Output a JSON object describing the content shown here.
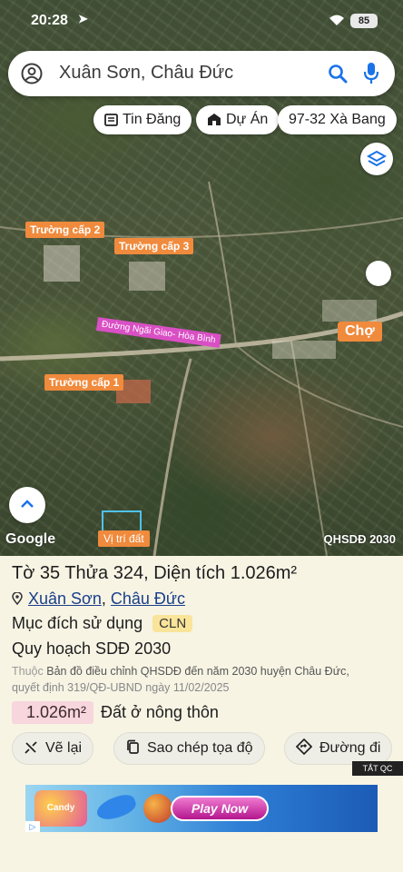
{
  "status_bar": {
    "time": "20:28",
    "battery": "85"
  },
  "search": {
    "query": "Xuân Sơn, Châu Đức"
  },
  "chips": [
    {
      "label": "Tin Đăng",
      "icon": "newspaper-icon"
    },
    {
      "label": "Dự Án",
      "icon": "building-icon"
    },
    {
      "label": "97-32 Xà Bang",
      "icon": ""
    }
  ],
  "map": {
    "labels": {
      "school2": "Trường cấp 2",
      "school3": "Trường cấp 3",
      "school1": "Trường cấp 1",
      "road": "Đường Ngãi Giao- Hòa Bình",
      "market": "Chợ",
      "parcel": "Vị trí đất"
    },
    "logo": "Google",
    "plan_label": "QHSDĐ 2030"
  },
  "parcel": {
    "title": "Tờ 35 Thửa 324, Diện tích 1.026m²",
    "commune": "Xuân Sơn",
    "separator": ",",
    "district": "Châu Đức",
    "use_purpose_label": "Mục đích sử dụng",
    "use_code": "CLN",
    "plan_title": "Quy hoạch SDĐ 2030",
    "plan_desc_lead": "Thuộc",
    "plan_desc_main": "Bản đồ điều chỉnh QHSDĐ đến năm 2030 huyện Châu Đức,",
    "plan_desc_decision": "quyết định 319/QĐ-UBND ngày 11/02/2025",
    "area_value": "1.026m²",
    "area_type": "Đất ở nông thôn"
  },
  "actions": [
    {
      "label": "Vẽ lại",
      "icon": "redraw-icon"
    },
    {
      "label": "Sao chép tọa độ",
      "icon": "copy-icon"
    },
    {
      "label": "Đường đi",
      "icon": "directions-icon"
    }
  ],
  "ad": {
    "close_label": "TẮT QC",
    "candy_text": "Candy Crush",
    "cta": "Play Now"
  },
  "colors": {
    "label_orange": "#f08a3c",
    "road_label": "#d94fc4",
    "link_blue": "#1a3f8a",
    "panel_bg": "#f7f4e4",
    "area_badge": "#f8d6dd",
    "use_badge": "#f9e49a"
  }
}
